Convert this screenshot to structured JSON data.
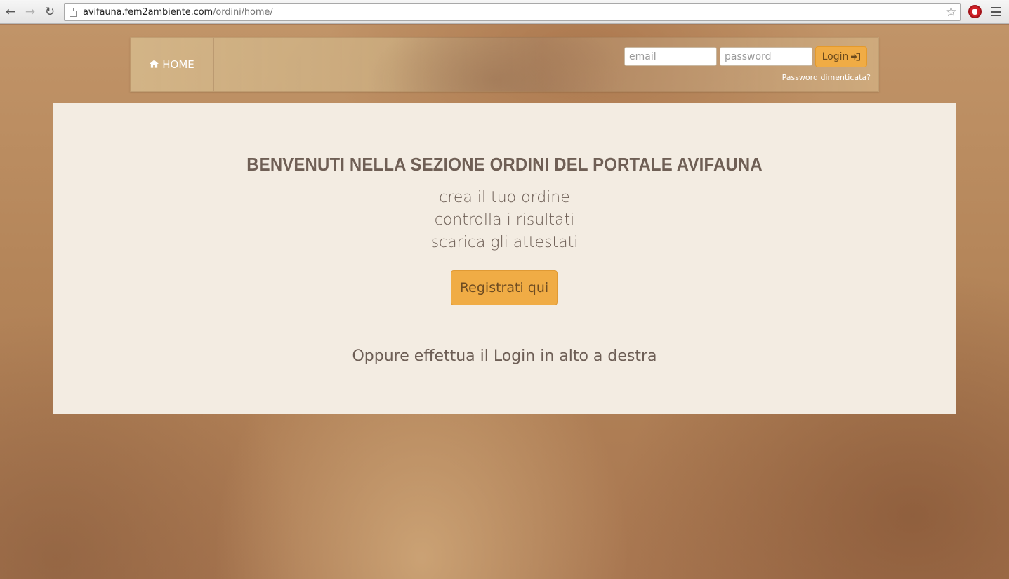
{
  "browser": {
    "url_host": "avifauna.fem2ambiente.com",
    "url_path": "/ordini/home/"
  },
  "navbar": {
    "home_label": "HOME",
    "email_placeholder": "email",
    "password_placeholder": "password",
    "login_label": "Login",
    "forgot_password": "Password dimenticata?"
  },
  "main": {
    "headline": "BENVENUTI NELLA SEZIONE ORDINI DEL PORTALE AVIFAUNA",
    "lines": [
      "crea il tuo ordine",
      "controlla i risultati",
      "scarica gli attestati"
    ],
    "register_label": "Registrati qui",
    "alt_text": "Oppure effettua il Login in alto a destra"
  },
  "colors": {
    "accent": "#f0ac45",
    "panel_bg": "#f3ece2",
    "text": "#6d5e55"
  },
  "icons": {
    "home": "home-icon",
    "login": "sign-in-icon"
  }
}
